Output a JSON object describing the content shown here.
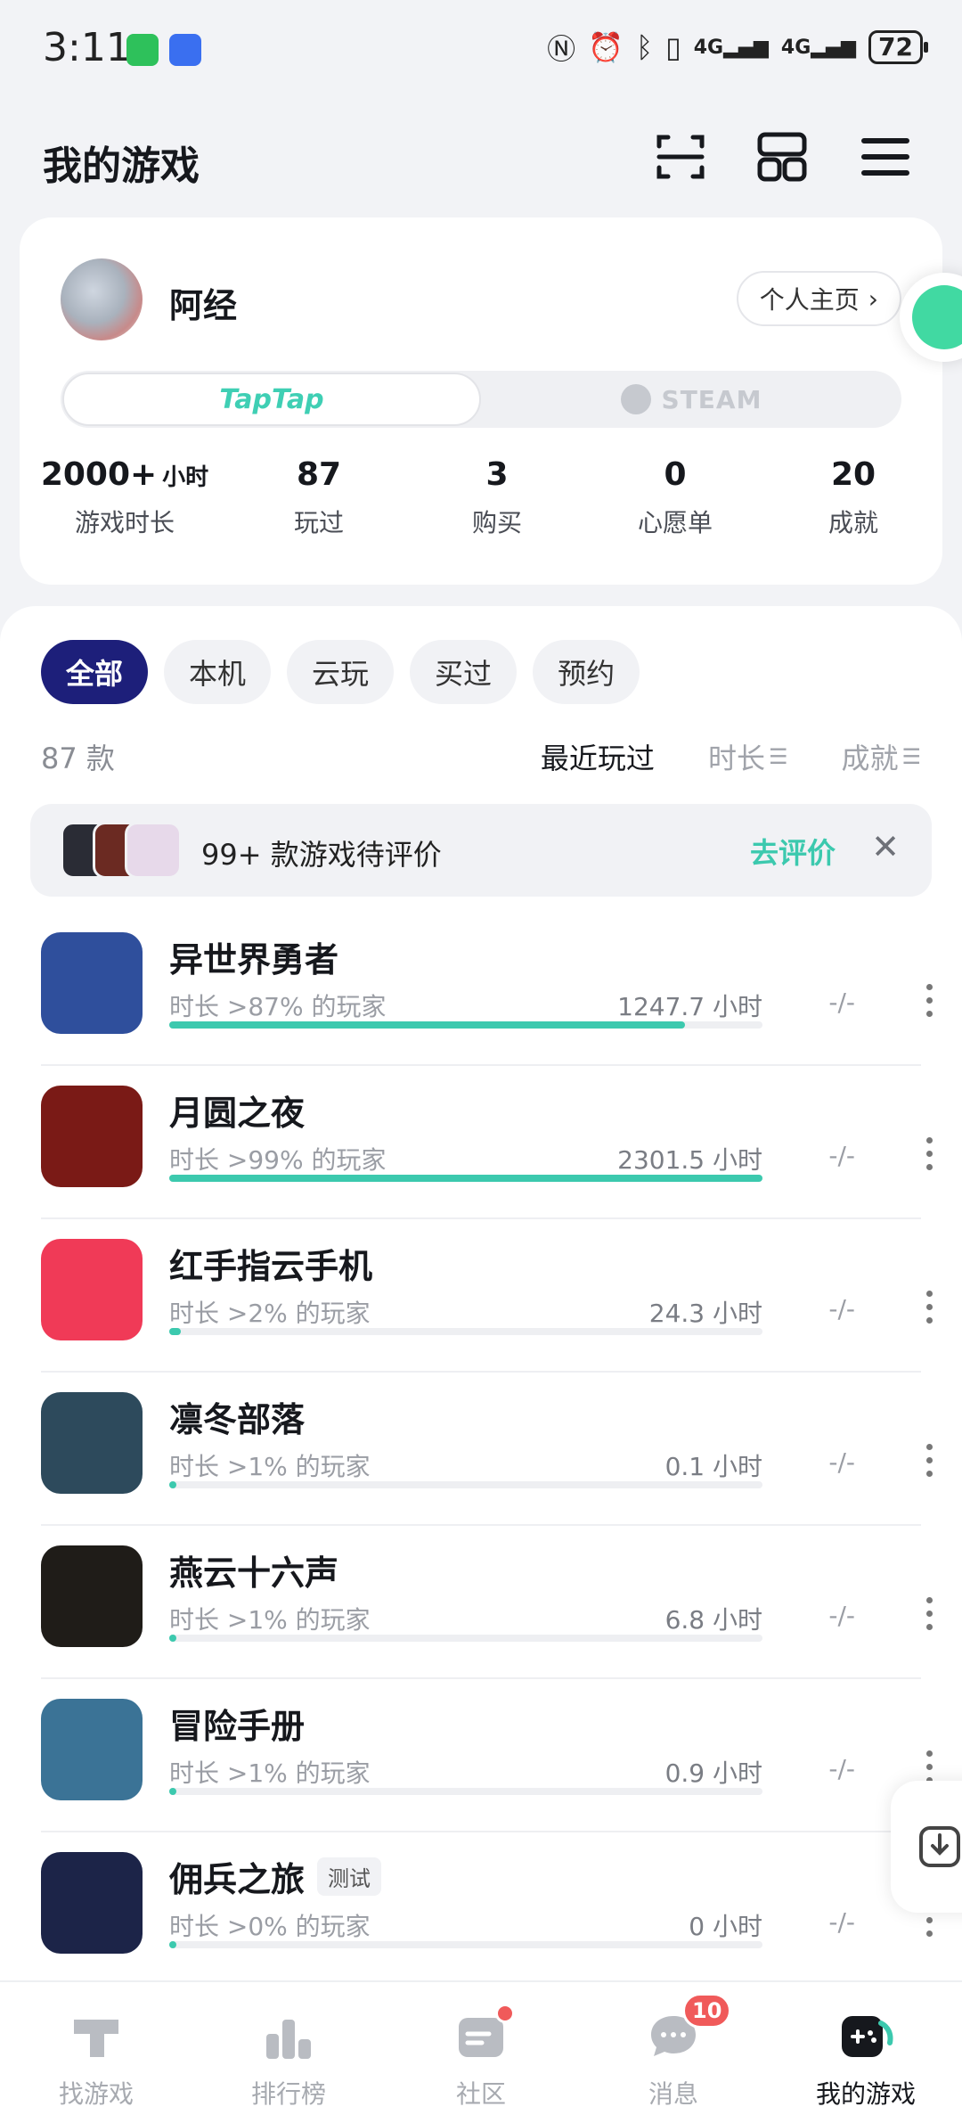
{
  "status_bar": {
    "time": "3:11",
    "battery": "72",
    "network": "4G"
  },
  "header": {
    "title": "我的游戏"
  },
  "profile": {
    "username": "阿经",
    "homepage_label": "个人主页",
    "platform_taptap": "TapTap",
    "platform_steam": "STEAM",
    "stats": [
      {
        "value": "2000+",
        "unit": "小时",
        "label": "游戏时长"
      },
      {
        "value": "87",
        "unit": "",
        "label": "玩过"
      },
      {
        "value": "3",
        "unit": "",
        "label": "购买"
      },
      {
        "value": "0",
        "unit": "",
        "label": "心愿单"
      },
      {
        "value": "20",
        "unit": "",
        "label": "成就"
      }
    ]
  },
  "filters": [
    "全部",
    "本机",
    "云玩",
    "买过",
    "预约"
  ],
  "list_meta": {
    "count": "87 款",
    "sorts": [
      "最近玩过",
      "时长",
      "成就"
    ]
  },
  "review_banner": {
    "text": "99+ 款游戏待评价",
    "action": "去评价"
  },
  "games": [
    {
      "name": "异世界勇者",
      "tag": "",
      "pct": "时长 >87% 的玩家",
      "hours": "1247.7 小时",
      "progress": 0.87,
      "rating": "-/-",
      "icon_color": "#2f4f9c"
    },
    {
      "name": "月圆之夜",
      "tag": "",
      "pct": "时长 >99% 的玩家",
      "hours": "2301.5 小时",
      "progress": 1.0,
      "rating": "-/-",
      "icon_color": "#7a1a16"
    },
    {
      "name": "红手指云手机",
      "tag": "",
      "pct": "时长 >2% 的玩家",
      "hours": "24.3 小时",
      "progress": 0.02,
      "rating": "-/-",
      "icon_color": "#f03a57"
    },
    {
      "name": "凛冬部落",
      "tag": "",
      "pct": "时长 >1% 的玩家",
      "hours": "0.1 小时",
      "progress": 0.01,
      "rating": "-/-",
      "icon_color": "#2d4a5c"
    },
    {
      "name": "燕云十六声",
      "tag": "",
      "pct": "时长 >1% 的玩家",
      "hours": "6.8 小时",
      "progress": 0.01,
      "rating": "-/-",
      "icon_color": "#1f1c18"
    },
    {
      "name": "冒险手册",
      "tag": "",
      "pct": "时长 >1% 的玩家",
      "hours": "0.9 小时",
      "progress": 0.01,
      "rating": "-/-",
      "icon_color": "#3b7396"
    },
    {
      "name": "佣兵之旅",
      "tag": "测试",
      "pct": "时长 >0% 的玩家",
      "hours": "0 小时",
      "progress": 0.0,
      "rating": "-/-",
      "icon_color": "#1c2448"
    }
  ],
  "bottom_nav": [
    {
      "label": "找游戏",
      "icon": "taptap-icon",
      "active": false
    },
    {
      "label": "排行榜",
      "icon": "ranking-icon",
      "active": false
    },
    {
      "label": "社区",
      "icon": "community-icon",
      "active": false,
      "dot": true
    },
    {
      "label": "消息",
      "icon": "message-icon",
      "active": false,
      "badge": "10"
    },
    {
      "label": "我的游戏",
      "icon": "gamepad-icon",
      "active": true
    }
  ],
  "colors": {
    "accent": "#3cc9ae",
    "active_chip": "#1d1f7a",
    "badge": "#f05a5a"
  }
}
